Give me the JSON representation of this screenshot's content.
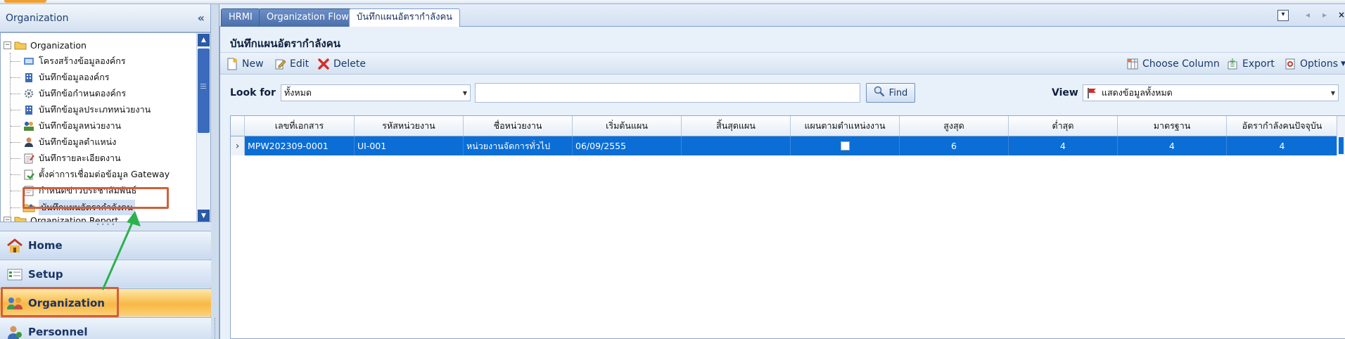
{
  "colors": {
    "accent": "#0a6ed6",
    "highlight_box": "#d0603c",
    "arrow": "#2db14e",
    "active_nav": "#f8b846"
  },
  "left_panel": {
    "title": "Organization",
    "collapse_glyph": "«",
    "tree": [
      {
        "label": "Organization",
        "level": 0,
        "expander": "−",
        "icon": "folder-icon"
      },
      {
        "label": "โครงสร้างข้อมูลองค์กร",
        "level": 1,
        "icon": "structure-icon"
      },
      {
        "label": "บันทึกข้อมูลองค์กร",
        "level": 1,
        "icon": "building-icon"
      },
      {
        "label": "บันทึกข้อกำหนดองค์กร",
        "level": 1,
        "icon": "settings-icon"
      },
      {
        "label": "บันทึกข้อมูลประเภทหน่วยงาน",
        "level": 1,
        "icon": "building-icon"
      },
      {
        "label": "บันทึกข้อมูลหน่วยงาน",
        "level": 1,
        "icon": "department-icon"
      },
      {
        "label": "บันทึกข้อมูลตำแหน่ง",
        "level": 1,
        "icon": "person-icon"
      },
      {
        "label": "บันทึกรายละเอียดงาน",
        "level": 1,
        "icon": "task-icon"
      },
      {
        "label": "ตั้งค่าการเชื่อมต่อข้อมูล Gateway",
        "level": 1,
        "icon": "gateway-icon"
      },
      {
        "label": "กำหนดข่าวประชาสัมพันธ์",
        "level": 1,
        "icon": "news-icon"
      },
      {
        "label": "บันทึกแผนอัตรากำลังคน",
        "level": 1,
        "icon": "manpower-icon"
      },
      {
        "label": "Organization Report",
        "level": 0,
        "expander": "−",
        "icon": "folder-icon"
      }
    ],
    "nav": [
      {
        "label": "Home",
        "icon": "home-icon"
      },
      {
        "label": "Setup",
        "icon": "setup-icon"
      },
      {
        "label": "Organization",
        "icon": "organization-icon"
      },
      {
        "label": "Personnel",
        "icon": "personnel-icon"
      }
    ]
  },
  "tabs": [
    {
      "label": "HRMI"
    },
    {
      "label": "Organization Flow"
    },
    {
      "label": "บันทึกแผนอัตรากำลังคน"
    }
  ],
  "tab_controls": {
    "dropdown": "▾",
    "prev": "◂",
    "next": "▸",
    "close": "×"
  },
  "page_title": "บันทึกแผนอัตรากำลังคน",
  "toolbar": {
    "new_label": "New",
    "edit_label": "Edit",
    "delete_label": "Delete",
    "choose_column_label": "Choose Column",
    "export_label": "Export",
    "options_label": "Options"
  },
  "filter": {
    "look_for_label": "Look for",
    "look_for_value": "ทั้งหมด",
    "search_value": "",
    "find_label": "Find",
    "view_label": "View",
    "view_value": "แสดงข้อมูลทั้งหมด"
  },
  "grid": {
    "columns": [
      "เลขที่เอกสาร",
      "รหัสหน่วยงาน",
      "ชื่อหน่วยงาน",
      "เริ่มต้นแผน",
      "สิ้นสุดแผน",
      "แผนตามตำแหน่งงาน",
      "สูงสุด",
      "ต่ำสุด",
      "มาตรฐาน",
      "อัตรากำลังคนปัจจุบัน"
    ],
    "rows": [
      [
        "MPW202309-0001",
        "UI-001",
        "หน่วยงานจัดการทั่วไป",
        "06/09/2555",
        "",
        "",
        "6",
        "4",
        "4",
        "4"
      ]
    ],
    "row_indicator": "›"
  }
}
